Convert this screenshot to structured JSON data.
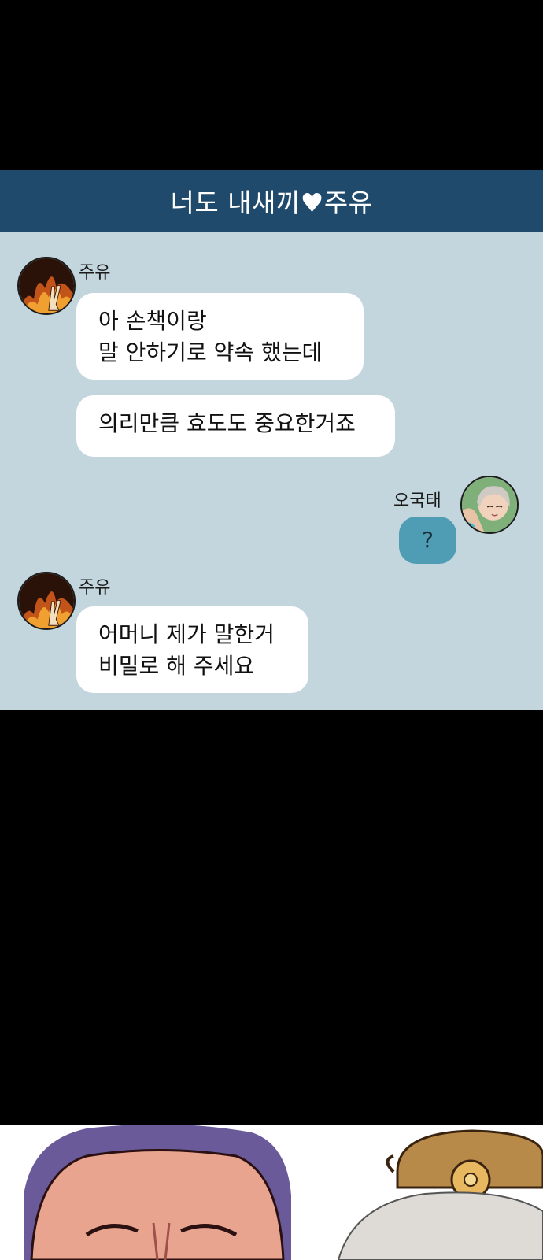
{
  "chat": {
    "title": "너도 내새끼♥주유",
    "colors": {
      "header": "#1f4a6b",
      "background": "#c3d5dd",
      "my_bubble": "#4e9db5"
    }
  },
  "messages": [
    {
      "sender": "주유",
      "avatar_icon": "fire-victory-avatar-icon",
      "bubbles": [
        "아 손책이랑\n말 안하기로 약속 했는데",
        "의리만큼 효도도 중요한거죠"
      ]
    },
    {
      "sender": "오국태",
      "avatar_icon": "woman-portrait-avatar-icon",
      "bubbles": [
        "?"
      ]
    },
    {
      "sender": "주유",
      "avatar_icon": "fire-victory-avatar-icon",
      "bubbles": [
        "어머니 제가 말한거\n비밀로 해 주세요"
      ]
    }
  ]
}
